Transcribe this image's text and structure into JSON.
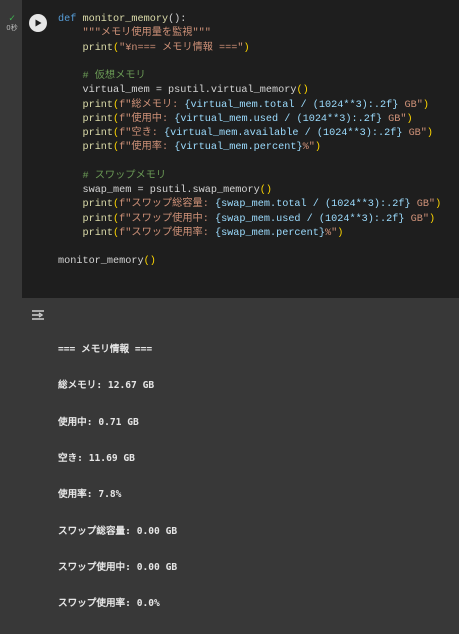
{
  "cell": {
    "run_status": "✓",
    "exec_time": "0秒"
  },
  "code": {
    "l1": {
      "kw": "def",
      "fn": "monitor_memory",
      "p": "():"
    },
    "l2": {
      "str": "\"\"\"メモリ使用量を監視\"\"\""
    },
    "l3": {
      "fn": "print",
      "p1": "(",
      "str": "\"¥n=== メモリ情報 ===\"",
      "p2": ")"
    },
    "l5": {
      "cm": "# 仮想メモリ"
    },
    "l6": {
      "a": "virtual_mem = psutil.virtual_memory",
      "p": "()"
    },
    "l7": {
      "fn": "print",
      "p1": "(",
      "s1": "f\"総メモリ: ",
      "e": "{virtual_mem.total / (1024**3):.2f}",
      "s2": " GB\"",
      "p2": ")"
    },
    "l8": {
      "fn": "print",
      "p1": "(",
      "s1": "f\"使用中: ",
      "e": "{virtual_mem.used / (1024**3):.2f}",
      "s2": " GB\"",
      "p2": ")"
    },
    "l9": {
      "fn": "print",
      "p1": "(",
      "s1": "f\"空き: ",
      "e": "{virtual_mem.available / (1024**3):.2f}",
      "s2": " GB\"",
      "p2": ")"
    },
    "l10": {
      "fn": "print",
      "p1": "(",
      "s1": "f\"使用率: ",
      "e": "{virtual_mem.percent}",
      "s2": "%\"",
      "p2": ")"
    },
    "l12": {
      "cm": "# スワップメモリ"
    },
    "l13": {
      "a": "swap_mem = psutil.swap_memory",
      "p": "()"
    },
    "l14": {
      "fn": "print",
      "p1": "(",
      "s1": "f\"スワップ総容量: ",
      "e": "{swap_mem.total / (1024**3):.2f}",
      "s2": " GB\"",
      "p2": ")"
    },
    "l15": {
      "fn": "print",
      "p1": "(",
      "s1": "f\"スワップ使用中: ",
      "e": "{swap_mem.used / (1024**3):.2f}",
      "s2": " GB\"",
      "p2": ")"
    },
    "l16": {
      "fn": "print",
      "p1": "(",
      "s1": "f\"スワップ使用率: ",
      "e": "{swap_mem.percent}",
      "s2": "%\"",
      "p2": ")"
    },
    "l18": {
      "a": "monitor_memory",
      "p": "()"
    }
  },
  "output": {
    "icon": "output-toggle-icon",
    "lines": [
      "=== メモリ情報 ===",
      "総メモリ: 12.67 GB",
      "使用中: 0.71 GB",
      "空き: 11.69 GB",
      "使用率: 7.8%",
      "スワップ総容量: 0.00 GB",
      "スワップ使用中: 0.00 GB",
      "スワップ使用率: 0.0%"
    ]
  },
  "colors": {
    "code_bg": "#1e1e1e",
    "page_bg": "#383838",
    "keyword": "#569cd6",
    "function": "#dcdcaa",
    "string": "#ce9178",
    "comment": "#6a9955",
    "check": "#3fb950"
  }
}
